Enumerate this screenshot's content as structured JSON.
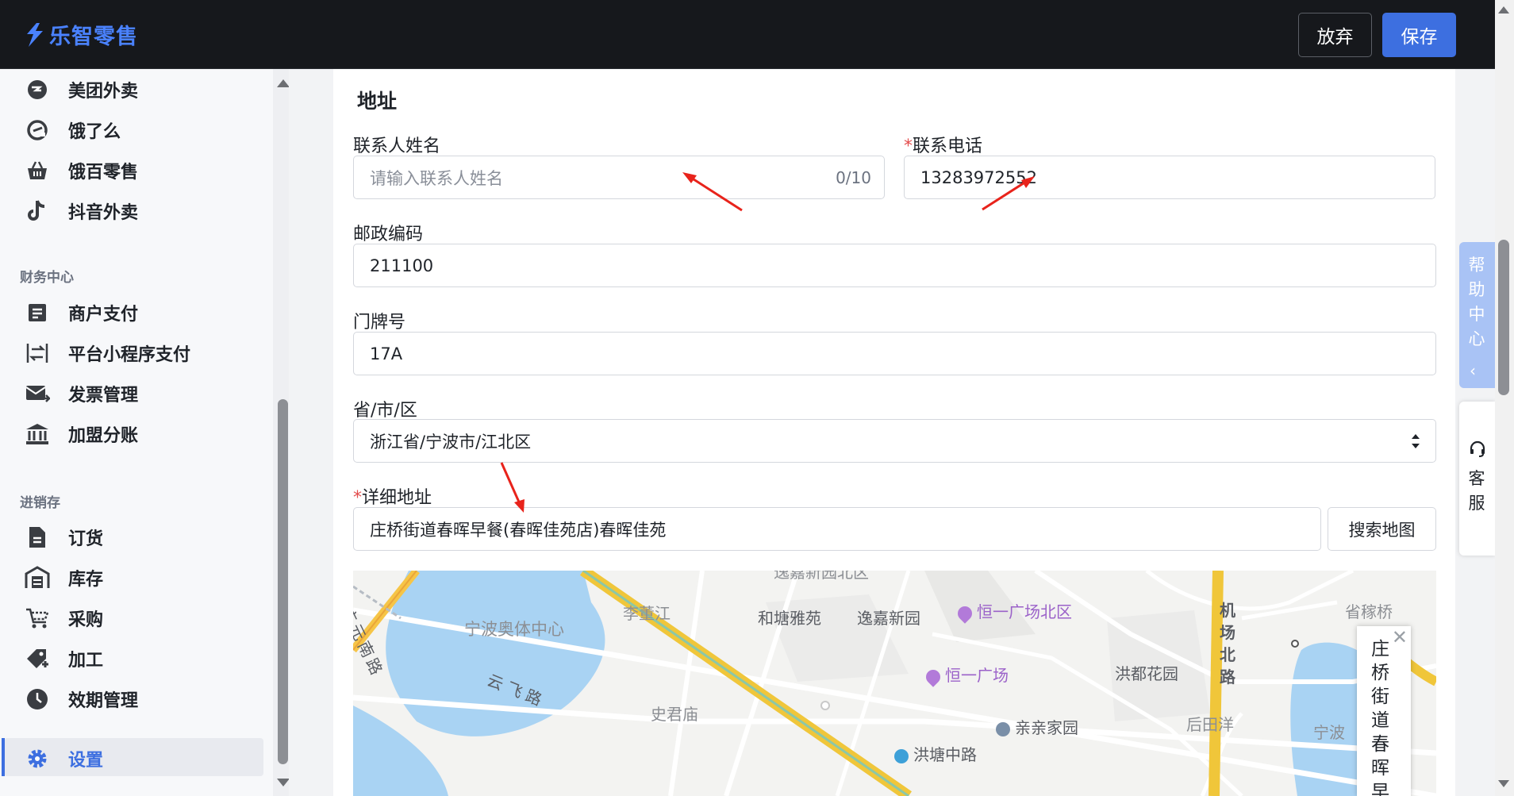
{
  "app": {
    "title": "乐智零售"
  },
  "toolbar": {
    "discard_label": "放弃",
    "save_label": "保存"
  },
  "sidebar": {
    "top_items": [
      {
        "label": "美团外卖",
        "icon": "meituan-icon"
      },
      {
        "label": "饿了么",
        "icon": "eleme-icon"
      },
      {
        "label": "饿百零售",
        "icon": "basket-icon"
      },
      {
        "label": "抖音外卖",
        "icon": "douyin-icon"
      }
    ],
    "finance": {
      "title": "财务中心",
      "items": [
        {
          "label": "商户支付",
          "icon": "document-icon"
        },
        {
          "label": "平台小程序支付",
          "icon": "transfer-icon"
        },
        {
          "label": "发票管理",
          "icon": "mail-icon"
        },
        {
          "label": "加盟分账",
          "icon": "bank-icon"
        }
      ]
    },
    "inventory": {
      "title": "进销存",
      "items": [
        {
          "label": "订货",
          "icon": "file-icon"
        },
        {
          "label": "库存",
          "icon": "warehouse-icon"
        },
        {
          "label": "采购",
          "icon": "cart-icon"
        },
        {
          "label": "加工",
          "icon": "tag-add-icon"
        },
        {
          "label": "效期管理",
          "icon": "clock-icon"
        }
      ]
    },
    "settings": {
      "label": "设置",
      "icon": "gear-icon",
      "active": true
    }
  },
  "form": {
    "section_title": "地址",
    "contact_name": {
      "label": "联系人姓名",
      "placeholder": "请输入联系人姓名",
      "value": "",
      "counter": "0/10"
    },
    "contact_phone": {
      "required_mark": "*",
      "label": "联系电话",
      "value": "13283972552"
    },
    "postal_code": {
      "label": "邮政编码",
      "value": "211100"
    },
    "door_number": {
      "label": "门牌号",
      "value": "17A"
    },
    "region": {
      "label": "省/市/区",
      "value": "浙江省/宁波市/江北区"
    },
    "address": {
      "required_mark": "*",
      "label": "详细地址",
      "value": "庄桥街道春晖早餐(春晖佳苑店)春晖佳苑"
    },
    "search_map_label": "搜索地图"
  },
  "map": {
    "labels": [
      "逸嘉新园北区",
      "广元南路",
      "李董江",
      "和塘雅苑",
      "逸嘉新园",
      "恒一广场北区",
      "机场北路",
      "省稼桥",
      "宁波奥体中心",
      "云飞路",
      "恒一广场",
      "洪都花园",
      "史君庙",
      "亲亲家园",
      "后田洋",
      "宁波",
      "洪塘中路"
    ],
    "infowindow": {
      "text": "庄桥街道春晖早",
      "close": "✕"
    }
  },
  "help": {
    "help_center": "帮助中心",
    "chevron": "‹",
    "customer_service": "客服"
  },
  "colors": {
    "primary": "#3d6fe0",
    "brand": "#4a82ff",
    "topbar": "#16181c",
    "required": "#e34d4d",
    "annotation": "#e8231b"
  }
}
